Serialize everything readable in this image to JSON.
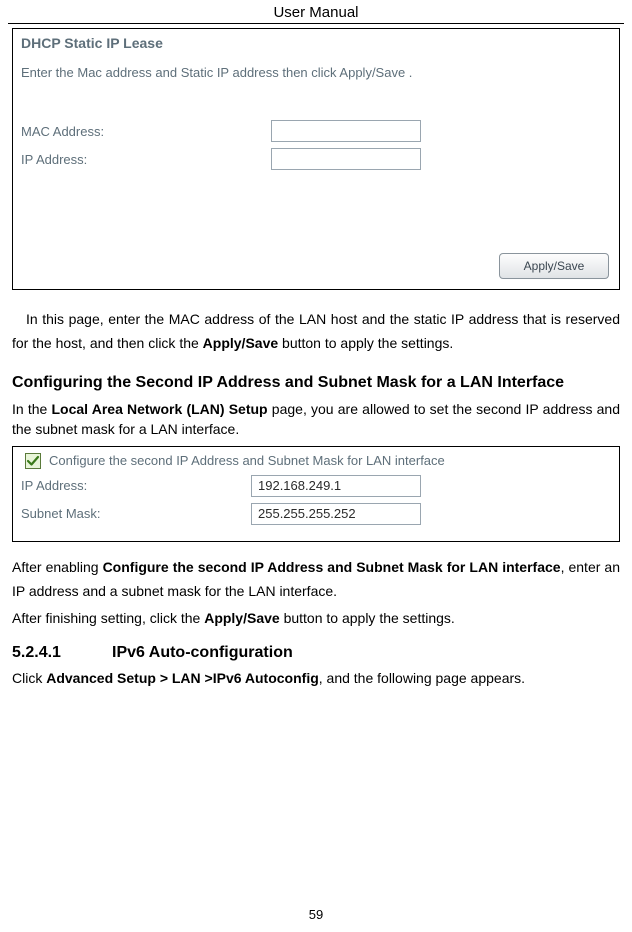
{
  "header": {
    "title": "User Manual"
  },
  "panel1": {
    "title": "DHCP Static IP Lease",
    "instruction": "Enter the Mac address and Static IP address then click Apply/Save .",
    "mac_label": "MAC Address:",
    "ip_label": "IP Address:",
    "mac_value": "",
    "ip_value": "",
    "apply_label": "Apply/Save"
  },
  "para1": {
    "t1": "In this page, enter the MAC address of the LAN host and the static IP address that is reserved for the host, and then click the ",
    "bold1": "Apply/Save",
    "t2": " button to apply the settings."
  },
  "heading1": "Configuring the Second IP Address and Subnet Mask for a LAN Interface",
  "para2": {
    "t1": "In the ",
    "bold1": "Local Area Network (LAN) Setup",
    "t2": " page, you are allowed to set the second IP address and the subnet mask for a LAN interface."
  },
  "panel2": {
    "checkbox_label": "Configure the second IP Address and Subnet Mask for LAN interface",
    "ip_label": "IP Address:",
    "mask_label": "Subnet Mask:",
    "ip_value": "192.168.249.1",
    "mask_value": "255.255.255.252"
  },
  "para3": {
    "t1": "After enabling ",
    "bold1": "Configure the second IP Address and Subnet Mask for LAN interface",
    "t2": ", enter an IP address and a subnet mask for the LAN interface."
  },
  "para4": {
    "t1": "After finishing setting, click the ",
    "bold1": "Apply/Save",
    "t2": " button to apply the settings."
  },
  "heading2": {
    "num": "5.2.4.1",
    "title": "IPv6 Auto-configuration"
  },
  "para5": {
    "t1": "Click ",
    "bold1": "Advanced Setup > LAN >IPv6 Autoconfig",
    "t2": ", and the following page appears."
  },
  "page_number": "59"
}
